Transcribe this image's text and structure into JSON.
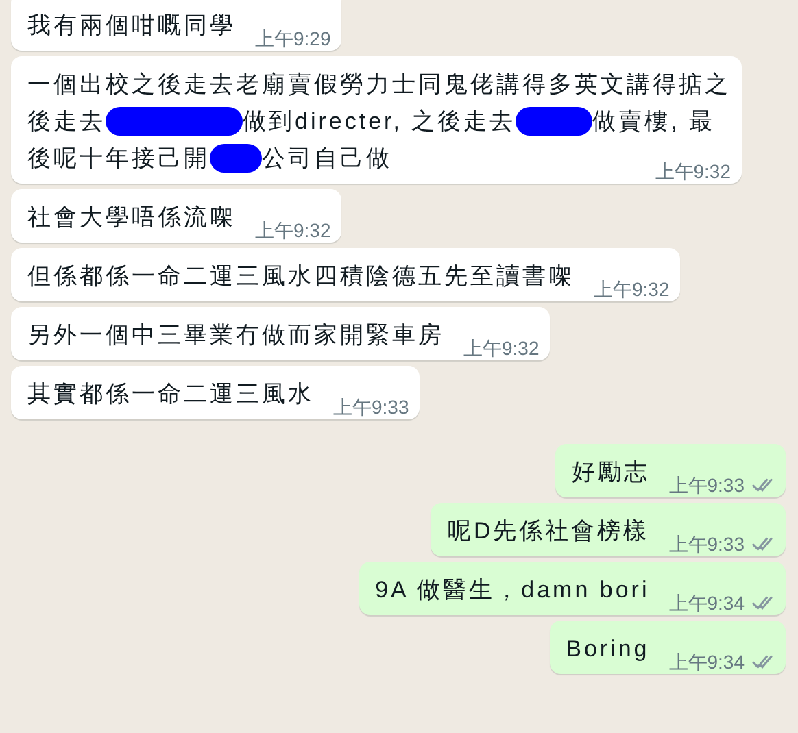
{
  "messages": [
    {
      "outgoing": false,
      "lines": [
        [
          {
            "kind": "text",
            "text": "我有兩個咁嘅同學"
          }
        ]
      ],
      "time": "上午9:29"
    },
    {
      "outgoing": false,
      "lines": [
        [
          {
            "kind": "text",
            "text": "一個出校之後走去老廟賣假勞力士同鬼佬講得多英文講得掂之"
          }
        ],
        [
          {
            "kind": "text",
            "text": "後走去"
          },
          {
            "kind": "redaction"
          },
          {
            "kind": "text",
            "text": "做到directer, 之後走去"
          },
          {
            "kind": "redaction"
          },
          {
            "kind": "text",
            "text": "做賣樓, 最"
          }
        ],
        [
          {
            "kind": "text",
            "text": "後呢十年接己開"
          },
          {
            "kind": "redaction"
          },
          {
            "kind": "text",
            "text": "公司自己做"
          }
        ]
      ],
      "time": "上午9:32"
    },
    {
      "outgoing": false,
      "lines": [
        [
          {
            "kind": "text",
            "text": "社會大學唔係流㗎"
          }
        ]
      ],
      "time": "上午9:32"
    },
    {
      "outgoing": false,
      "lines": [
        [
          {
            "kind": "text",
            "text": "但係都係一命二運三風水四積陰德五先至讀書㗎"
          }
        ]
      ],
      "time": "上午9:32"
    },
    {
      "outgoing": false,
      "lines": [
        [
          {
            "kind": "text",
            "text": "另外一個中三畢業冇做而家開緊車房"
          }
        ]
      ],
      "time": "上午9:32"
    },
    {
      "outgoing": false,
      "lines": [
        [
          {
            "kind": "text",
            "text": "其實都係一命二運三風水"
          }
        ]
      ],
      "time": "上午9:33"
    },
    {
      "outgoing": true,
      "lines": [
        [
          {
            "kind": "text",
            "text": "好勵志"
          }
        ]
      ],
      "time": "上午9:33",
      "read": false
    },
    {
      "outgoing": true,
      "lines": [
        [
          {
            "kind": "text",
            "text": "呢D先係社會榜樣"
          }
        ]
      ],
      "time": "上午9:33",
      "read": false
    },
    {
      "outgoing": true,
      "lines": [
        [
          {
            "kind": "text",
            "text": "9A 做醫生，damn bori"
          }
        ]
      ],
      "time": "上午9:34",
      "read": false
    },
    {
      "outgoing": true,
      "lines": [
        [
          {
            "kind": "text",
            "text": "Boring"
          }
        ]
      ],
      "time": "上午9:34",
      "read": false
    }
  ]
}
